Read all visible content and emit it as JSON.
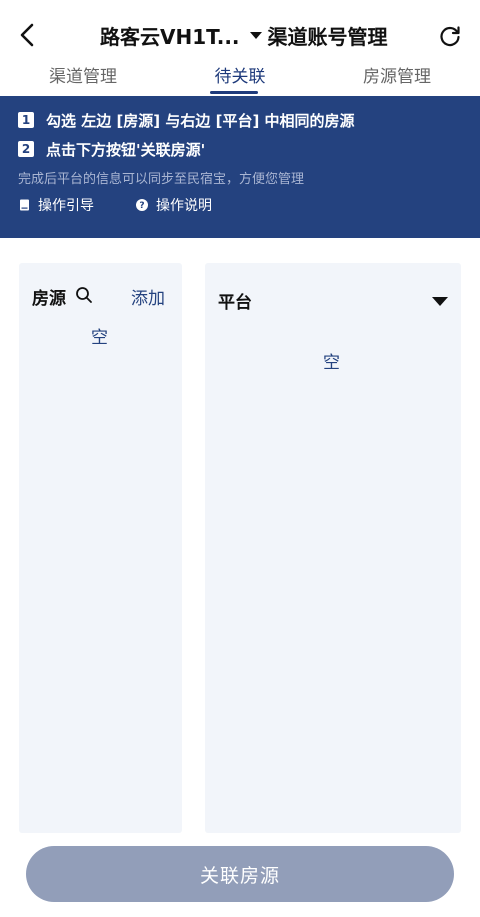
{
  "header": {
    "title": "路客云VH1T...",
    "subtitle": "渠道账号管理"
  },
  "tabs": [
    {
      "label": "渠道管理",
      "active": false
    },
    {
      "label": "待关联",
      "active": true
    },
    {
      "label": "房源管理",
      "active": false
    }
  ],
  "banner": {
    "steps": [
      {
        "num": "1",
        "text": "勾选 左边 [房源] 与右边 [平台] 中相同的房源"
      },
      {
        "num": "2",
        "text": "点击下方按钮'关联房源'"
      }
    ],
    "note": "完成后平台的信息可以同步至民宿宝，方便您管理",
    "guide_label": "操作引导",
    "help_label": "操作说明"
  },
  "left_panel": {
    "title": "房源",
    "add_label": "添加",
    "empty_text": "空"
  },
  "right_panel": {
    "title": "平台",
    "empty_text": "空"
  },
  "footer": {
    "button_label": "关联房源"
  },
  "colors": {
    "accent": "#24427f",
    "panel_bg": "#f2f5fa",
    "button_disabled": "#929eb9"
  }
}
